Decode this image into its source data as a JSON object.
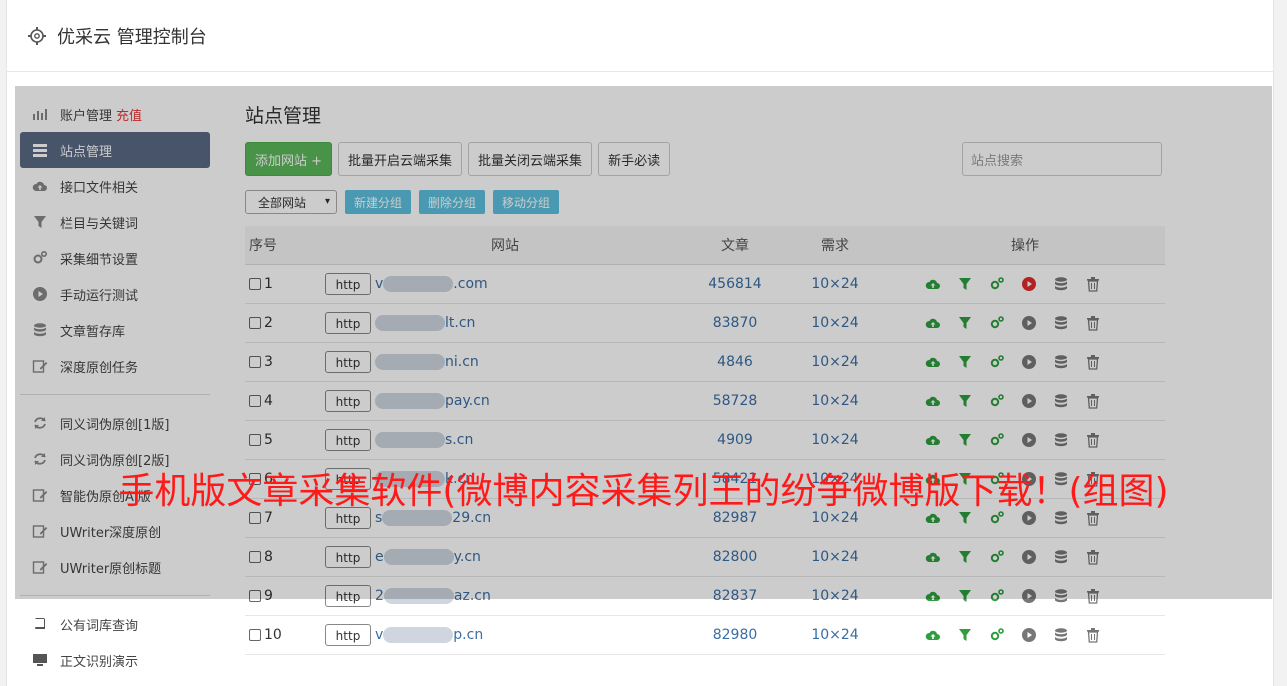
{
  "app": {
    "title": "优采云 管理控制台"
  },
  "sidebar": {
    "items": [
      {
        "label": "账户管理",
        "extra": "充值",
        "icon": "chart-icon"
      },
      {
        "label": "站点管理",
        "icon": "list-icon",
        "active": true
      },
      {
        "label": "接口文件相关",
        "icon": "cloud-upload-icon"
      },
      {
        "label": "栏目与关键词",
        "icon": "filter-icon"
      },
      {
        "label": "采集细节设置",
        "icon": "gears-icon"
      },
      {
        "label": "手动运行测试",
        "icon": "play-circle-icon"
      },
      {
        "label": "文章暂存库",
        "icon": "database-icon"
      },
      {
        "label": "深度原创任务",
        "icon": "edit-icon"
      }
    ],
    "items2": [
      {
        "label": "同义词伪原创[1版]",
        "icon": "refresh-icon"
      },
      {
        "label": "同义词伪原创[2版]",
        "icon": "refresh-icon"
      },
      {
        "label": "智能伪原创AI版",
        "icon": "edit-icon"
      },
      {
        "label": "UWriter深度原创",
        "icon": "edit-icon"
      },
      {
        "label": "UWriter原创标题",
        "icon": "edit-icon"
      }
    ],
    "items3": [
      {
        "label": "公有词库查询",
        "icon": "book-icon"
      },
      {
        "label": "正文识别演示",
        "icon": "monitor-icon"
      }
    ]
  },
  "main": {
    "title": "站点管理",
    "buttons": {
      "add": "添加网站 +",
      "batch_on": "批量开启云端采集",
      "batch_off": "批量关闭云端采集",
      "guide": "新手必读"
    },
    "search_placeholder": "站点搜索",
    "group_select": "全部网站",
    "group_buttons": {
      "new": "新建分组",
      "delete": "删除分组",
      "move": "移动分组"
    },
    "columns": [
      "序号",
      "网站",
      "文章",
      "需求",
      "操作"
    ],
    "rows": [
      {
        "no": "1",
        "proto": "http",
        "prefix": "v",
        "suffix": ".com",
        "articles": "456814",
        "need": "10×24",
        "play_red": true
      },
      {
        "no": "2",
        "proto": "http",
        "prefix": "",
        "suffix": "lt.cn",
        "articles": "83870",
        "need": "10×24"
      },
      {
        "no": "3",
        "proto": "http",
        "prefix": "",
        "suffix": "ni.cn",
        "articles": "4846",
        "need": "10×24"
      },
      {
        "no": "4",
        "proto": "http",
        "prefix": "",
        "suffix": "pay.cn",
        "articles": "58728",
        "need": "10×24"
      },
      {
        "no": "5",
        "proto": "http",
        "prefix": "",
        "suffix": "s.cn",
        "articles": "4909",
        "need": "10×24"
      },
      {
        "no": "6",
        "proto": "http",
        "prefix": "",
        "suffix": "k.cn",
        "articles": "58421",
        "need": "10×24"
      },
      {
        "no": "7",
        "proto": "http",
        "prefix": "s",
        "suffix": "29.cn",
        "articles": "82987",
        "need": "10×24"
      },
      {
        "no": "8",
        "proto": "http",
        "prefix": "e",
        "suffix": "y.cn",
        "articles": "82800",
        "need": "10×24"
      },
      {
        "no": "9",
        "proto": "http",
        "prefix": "2",
        "suffix": "az.cn",
        "articles": "82837",
        "need": "10×24"
      },
      {
        "no": "10",
        "proto": "http",
        "prefix": "v",
        "suffix": "p.cn",
        "articles": "82980",
        "need": "10×24"
      }
    ]
  },
  "banner": "手机版文章采集软件(微博内容采集列王的纷争微博版下载！(组图)",
  "colors": {
    "active": "#5a6a85",
    "green": "#5cb85c",
    "link": "#3a6ea5",
    "banner": "#ff1a1a"
  }
}
